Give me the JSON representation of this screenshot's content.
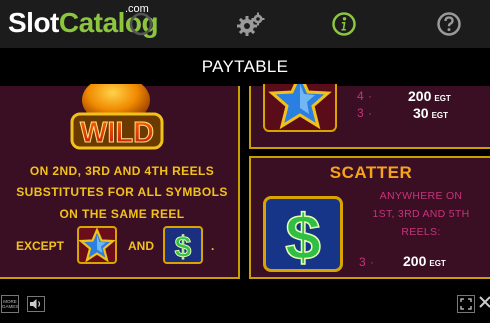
{
  "header": {
    "logo_slot": "Slot",
    "logo_catalog": "Catalog",
    "logo_com": ".com",
    "icons": [
      "gear-icon",
      "info-icon",
      "help-icon"
    ]
  },
  "title": "PAYTABLE",
  "wild_panel": {
    "wild_label": "WILD",
    "line1": "ON 2ND, 3RD AND 4TH REELS",
    "line2": "SUBSTITUTES FOR ALL SYMBOLS",
    "line3": "ON THE SAME REEL",
    "except_label": "EXCEPT",
    "and_label": "AND",
    "period": "."
  },
  "star_panel": {
    "rows": [
      {
        "count": "4",
        "dot": "·",
        "amount": "200",
        "unit": "EGT"
      },
      {
        "count": "3",
        "dot": "·",
        "amount": "30",
        "unit": "EGT"
      }
    ]
  },
  "scatter_panel": {
    "title": "SCATTER",
    "desc1": "ANYWHERE ON",
    "desc2": "1ST, 3RD AND 5TH",
    "desc3": "REELS:",
    "row": {
      "count": "3",
      "dot": "·",
      "amount": "200",
      "unit": "EGT"
    }
  },
  "footer": {
    "more_games_line1": "MORE",
    "more_games_line2": "GAMES"
  },
  "colors": {
    "accent_green": "#8cc63f",
    "gold": "#f2c21a",
    "panel_bg": "#3a0f24",
    "pink": "#c8337a"
  }
}
